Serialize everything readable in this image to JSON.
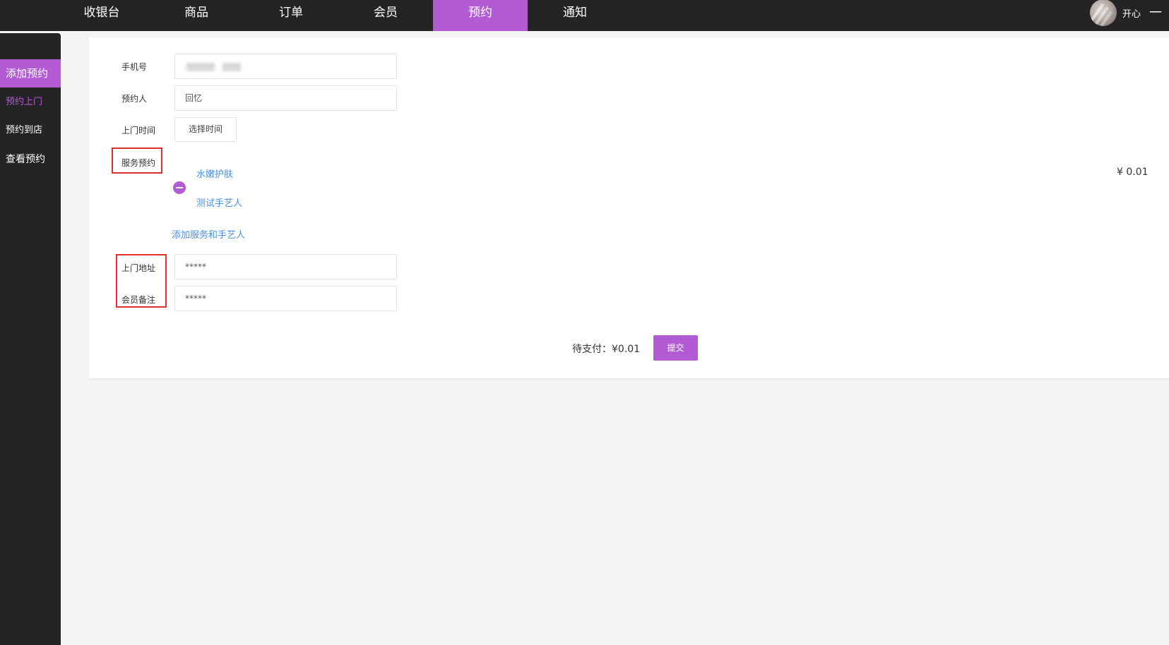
{
  "nav": {
    "items": [
      {
        "label": "收银台"
      },
      {
        "label": "商品"
      },
      {
        "label": "订单"
      },
      {
        "label": "会员"
      },
      {
        "label": "预约"
      },
      {
        "label": "通知"
      }
    ],
    "active": "预约",
    "user": {
      "name": "开心",
      "menu_glyph": "一"
    }
  },
  "sidebar": {
    "items": [
      {
        "label": "添加预约"
      },
      {
        "label": "预约上门"
      },
      {
        "label": "预约到店"
      },
      {
        "label": "查看预约"
      }
    ]
  },
  "form": {
    "phone": {
      "label": "手机号",
      "value": ""
    },
    "booker": {
      "label": "预约人",
      "value": "回忆"
    },
    "visit_time": {
      "label": "上门时间",
      "button": "选择时间"
    },
    "service": {
      "label": "服务预约",
      "service_name": "水嫩护肤",
      "artisan_name": "测试手艺人",
      "price": "¥ 0.01",
      "add_link": "添加服务和手艺人"
    },
    "address": {
      "label": "上门地址",
      "value": "*****"
    },
    "remark": {
      "label": "会员备注",
      "value": "*****"
    }
  },
  "footer": {
    "total_text": "待支付：¥0.01",
    "submit_label": "提交"
  },
  "colors": {
    "accent": "#b25bd4",
    "dark": "#252326",
    "link": "#4a90e2",
    "highlight": "#e0302b"
  }
}
